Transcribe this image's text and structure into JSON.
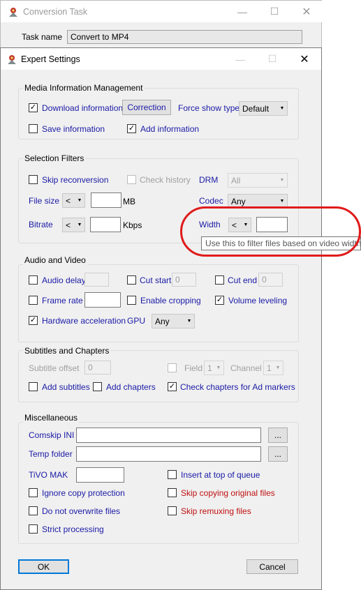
{
  "background_window": {
    "title": "Conversion Task",
    "task_name_label": "Task name",
    "task_name_value": "Convert to MP4"
  },
  "dialog": {
    "title": "Expert Settings",
    "media_info": {
      "group_title": "Media Information Management",
      "download_info": "Download information",
      "correction": "Correction",
      "force_show_type": "Force show type",
      "force_show_type_value": "Default",
      "save_info": "Save information",
      "add_info": "Add information"
    },
    "selection_filters": {
      "group_title": "Selection Filters",
      "skip_reconversion": "Skip reconversion",
      "check_history": "Check history",
      "drm": "DRM",
      "drm_value": "All",
      "file_size": "File size",
      "file_size_op": "<",
      "file_size_unit": "MB",
      "codec": "Codec",
      "codec_value": "Any",
      "bitrate": "Bitrate",
      "bitrate_op": "<",
      "bitrate_unit": "Kbps",
      "width": "Width",
      "width_op": "<"
    },
    "audio_video": {
      "group_title": "Audio and Video",
      "audio_delay": "Audio delay",
      "cut_start": "Cut start",
      "cut_start_value": "0",
      "cut_end": "Cut end",
      "cut_end_value": "0",
      "frame_rate": "Frame rate",
      "enable_cropping": "Enable cropping",
      "volume_leveling": "Volume leveling",
      "hardware_acceleration": "Hardware acceleration",
      "gpu": "GPU",
      "gpu_value": "Any"
    },
    "subtitles_chapters": {
      "group_title": "Subtitles and Chapters",
      "subtitle_offset": "Subtitle offset",
      "subtitle_offset_value": "0",
      "field": "Field",
      "field_value": "1",
      "channel": "Channel",
      "channel_value": "1",
      "add_subtitles": "Add subtitles",
      "add_chapters": "Add chapters",
      "check_chapters_ad": "Check chapters for Ad markers"
    },
    "misc": {
      "group_title": "Miscellaneous",
      "comskip_ini": "Comskip INI",
      "temp_folder": "Temp folder",
      "browse": "...",
      "tivo_mak": "TiVO MAK",
      "insert_top_queue": "Insert at top of queue",
      "ignore_copy_protection": "Ignore copy protection",
      "skip_copying_original": "Skip copying original files",
      "do_not_overwrite": "Do not overwrite files",
      "skip_remuxing": "Skip remuxing files",
      "strict_processing": "Strict processing"
    },
    "ok": "OK",
    "cancel": "Cancel"
  },
  "tooltip": "Use this to filter files based on video width",
  "check_glyph": "✓",
  "colors": {
    "link_blue": "#1a1aa6",
    "warning_red": "#c01010",
    "annotation_red": "#e01a1a"
  }
}
